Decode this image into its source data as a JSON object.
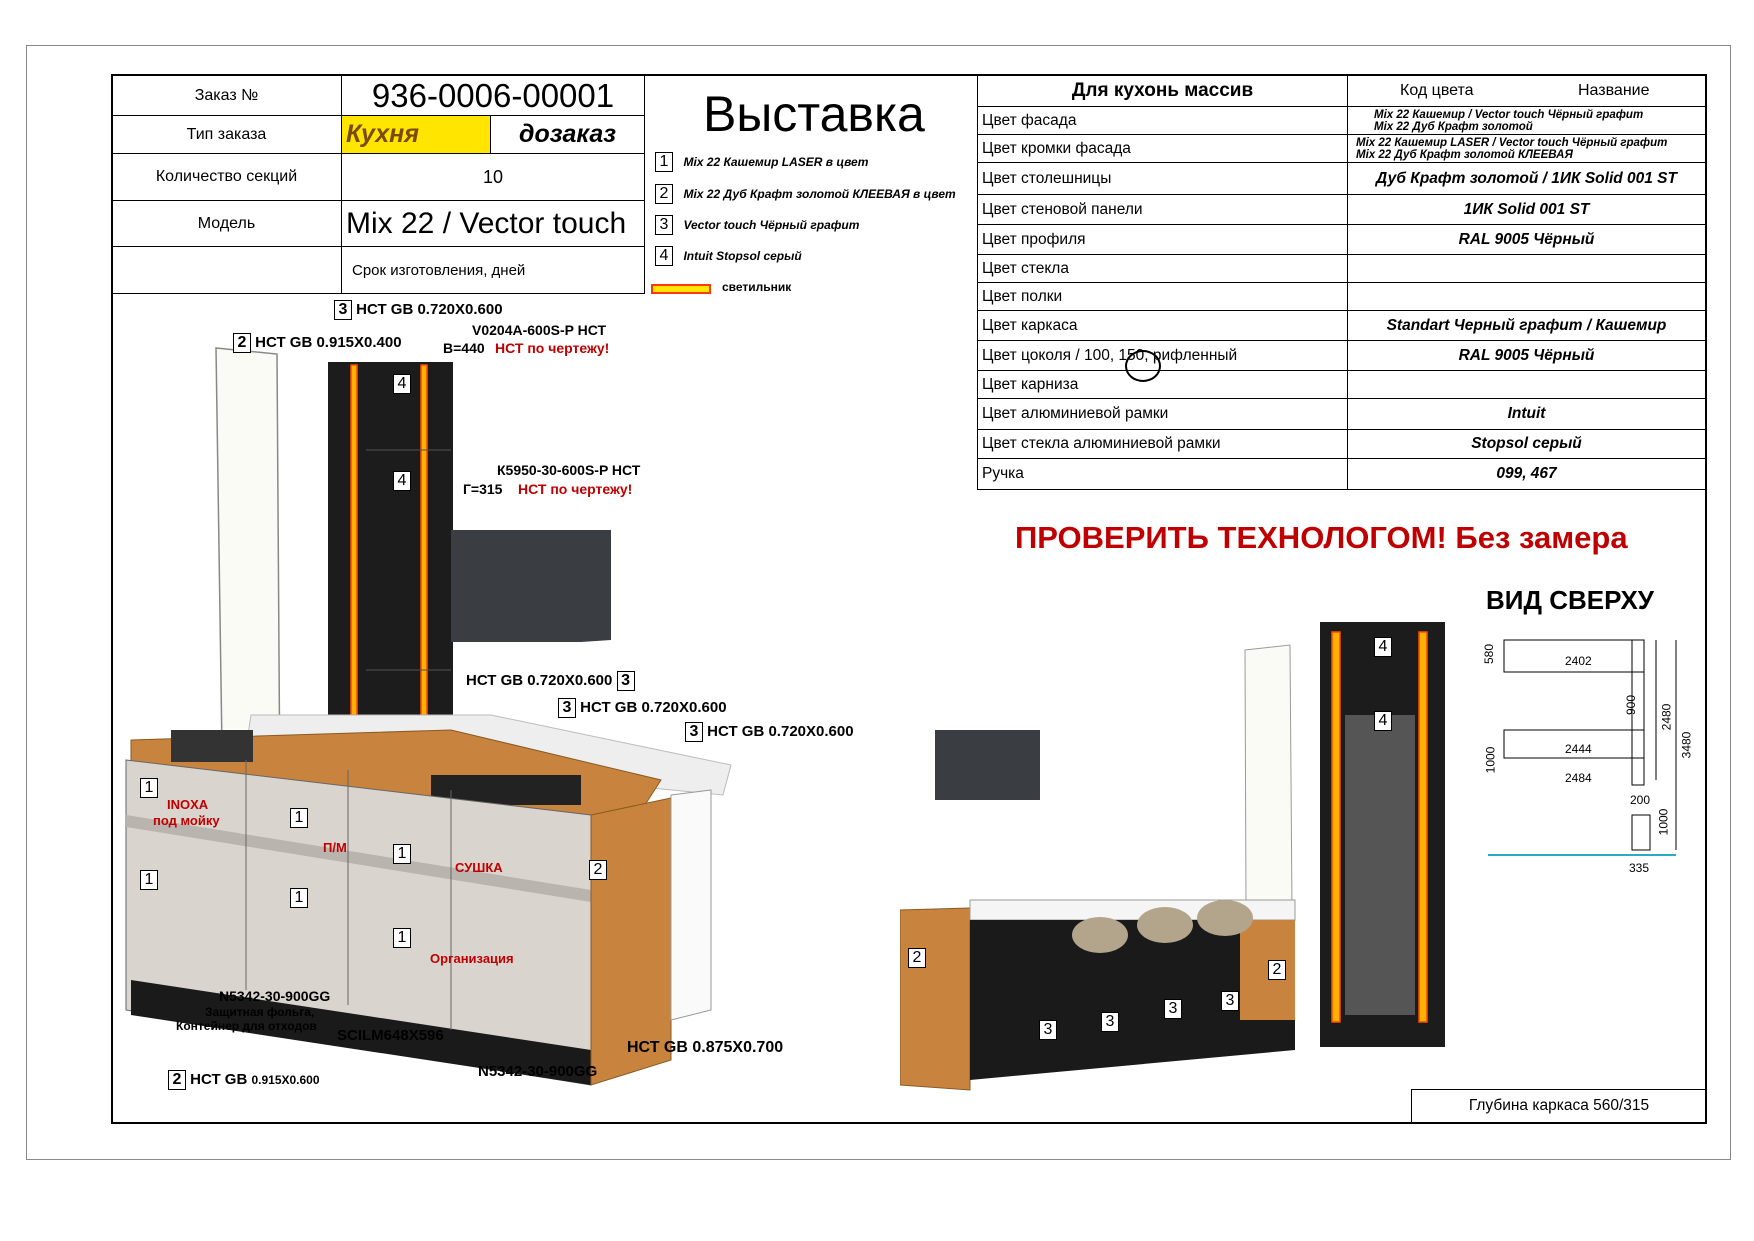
{
  "order": {
    "number_label": "Заказ №",
    "number": "936-0006-00001",
    "type_label": "Тип заказа",
    "type_value": "Кухня",
    "type_extra": "дозаказ",
    "sections_label": "Количество секций",
    "sections_value": "10",
    "model_label": "Модель",
    "model_value": "Mix 22 / Vector touch",
    "deadline_label": "Срок изготовления, дней"
  },
  "title": "Выставка",
  "legend": [
    {
      "num": "1",
      "text": "Mix 22 Кашемир LASER в цвет"
    },
    {
      "num": "2",
      "text": "Mix 22 Дуб Крафт золотой КЛЕЕВАЯ в цвет"
    },
    {
      "num": "3",
      "text": "Vector touch Чёрный графит"
    },
    {
      "num": "4",
      "text": "Intuit Stopsol серый"
    }
  ],
  "lamp_label": "светильник",
  "spec": {
    "header": "Для кухонь массив",
    "code_header": "Код цвета",
    "name_header": "Название",
    "rows": [
      {
        "label": "Цвет фасада",
        "v1": "Mix 22 Кашемир / Vector touch Чёрный графит",
        "v2": "Mix 22 Дуб Крафт золотой"
      },
      {
        "label": "Цвет кромки фасада",
        "v1": "Mix 22 Кашемир LASER / Vector touch Чёрный графит",
        "v2": "Mix 22 Дуб Крафт золотой КЛЕЕВАЯ"
      },
      {
        "label": "Цвет столешницы",
        "v1": "Дуб Крафт золотой / 1ИК Solid 001 ST"
      },
      {
        "label": "Цвет стеновой панели",
        "v1": "1ИК Solid 001 ST"
      },
      {
        "label": "Цвет профиля",
        "v1": "RAL 9005 Чёрный"
      },
      {
        "label": "Цвет стекла",
        "v1": ""
      },
      {
        "label": "Цвет полки",
        "v1": ""
      },
      {
        "label": "Цвет каркаса",
        "v1": "Standart Черный графит / Кашемир"
      },
      {
        "label": "Цвет цоколя / 100, 150, рифленный",
        "v1": "RAL 9005 Чёрный"
      },
      {
        "label": "Цвет карниза",
        "v1": ""
      },
      {
        "label": "Цвет алюминиевой рамки",
        "v1": "Intuit"
      },
      {
        "label": "Цвет стекла алюминиевой рамки",
        "v1": "Stopsol серый"
      },
      {
        "label": "Ручка",
        "v1": "099, 467"
      }
    ]
  },
  "warning": "ПРОВЕРИТЬ ТЕХНОЛОГОМ! Без замера",
  "top_view_title": "ВИД СВЕРХУ",
  "top_view_dims": [
    "580",
    "2402",
    "900",
    "2480",
    "3480",
    "1000",
    "2444",
    "2484",
    "200",
    "1000",
    "335"
  ],
  "depth_note": "Глубина каркаса 560/315",
  "callouts": {
    "c1": "НСТ GB 0.720Х0.600",
    "c2": "НСТ GB 0.915Х0.400",
    "c3": "V0204A-600S-P НСТ",
    "c3b": "В=440",
    "c3r": "НСТ по чертежу!",
    "c4": "К5950-30-600S-P НСТ",
    "c4b": "Г=315",
    "c4r": "НСТ по чертежу!",
    "c5": "НСТ GB 0.720Х0.600",
    "c6": "НСТ GB 0.720Х0.600",
    "c7": "НСТ GB 0.720Х0.600",
    "inoxa": "INOXA",
    "inoxa2": "под мойку",
    "pm": "П/М",
    "dry": "СУШКА",
    "org": "Организация",
    "n1": "N5342-30-900GG",
    "n1b": "Защитная фольга,",
    "n1c": "Контейнер для отходов",
    "scilm": "SCILM648X596",
    "n2": "N5342-30-900GG",
    "hct1": "НСТ GB 0.875Х0.700",
    "hct2": "НСТ GB",
    "hct2b": "0.915Х0.600"
  },
  "colors": {
    "accent_red": "#c00000",
    "highlight_yellow": "#ffe500",
    "lamp_orange": "#ff6a00",
    "wood": "#c8843e",
    "cashmere": "#d9d4cd",
    "black": "#1a1a1a"
  }
}
